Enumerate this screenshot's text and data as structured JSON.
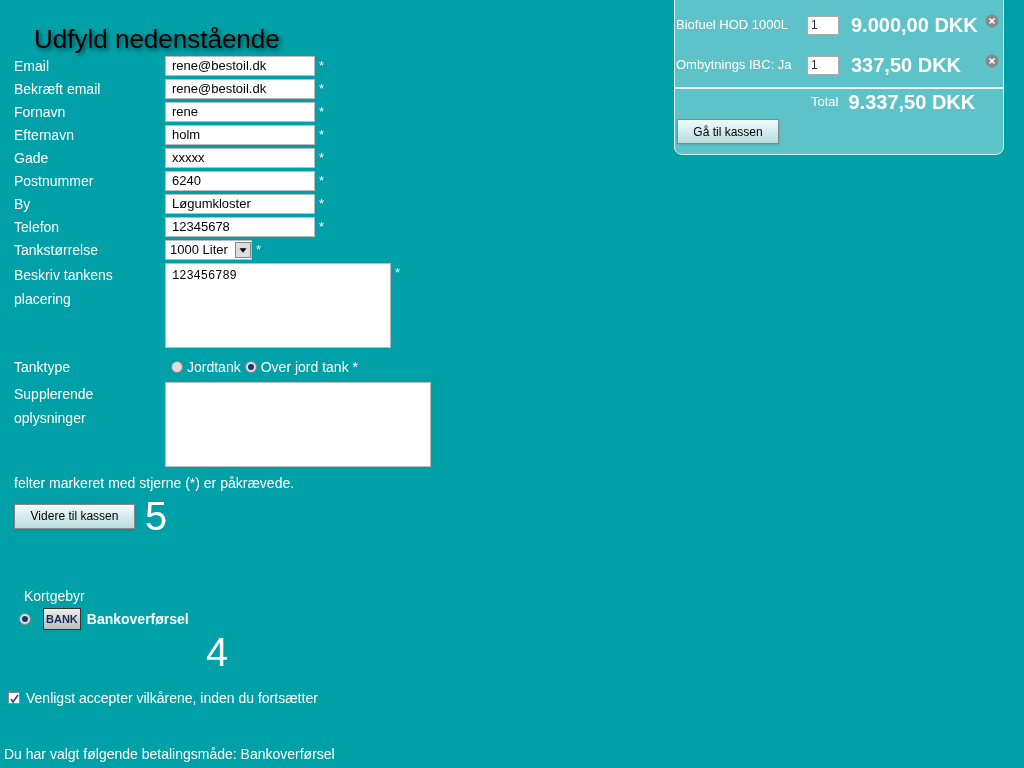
{
  "heading": "Udfyld nedenstående",
  "fields": [
    {
      "label": "Email",
      "value": "rene@bestoil.dk",
      "required": "*"
    },
    {
      "label": "Bekræft email",
      "value": "rene@bestoil.dk",
      "required": "*"
    },
    {
      "label": "Fornavn",
      "value": "rene",
      "required": "*"
    },
    {
      "label": "Efternavn",
      "value": "holm",
      "required": "*"
    },
    {
      "label": "Gade",
      "value": "xxxxx",
      "required": "*"
    },
    {
      "label": "Postnummer",
      "value": "6240",
      "required": "*"
    },
    {
      "label": "By",
      "value": "Løgumkloster",
      "required": "*"
    },
    {
      "label": "Telefon",
      "value": "12345678",
      "required": "*"
    }
  ],
  "tank_size": {
    "label": "Tankstørrelse",
    "value": "1000 Liter",
    "required": "*"
  },
  "placement": {
    "label": "Beskriv tankens placering",
    "value": "123456789",
    "required": "*"
  },
  "tank_type": {
    "label": "Tanktype",
    "options": [
      {
        "label": "Jordtank",
        "selected": false
      },
      {
        "label": "Over jord tank *",
        "selected": true
      }
    ]
  },
  "extra": {
    "label": "Supplerende oplysninger"
  },
  "note": "felter markeret med stjerne (*) er påkrævede.",
  "submit": "Videre til kassen",
  "step_a": "5",
  "fee_label": "Kortgebyr",
  "payment": {
    "logo_text": "BANK",
    "label": "Bankoverførsel",
    "selected": true
  },
  "step_b": "4",
  "terms": {
    "label": "Venligst accepter vilkårene, inden du fortsætter",
    "checked": true
  },
  "summary": "Du har valgt følgende betalingsmåde: Bankoverførsel",
  "cart": {
    "items": [
      {
        "name": "Biofuel HOD 1000L",
        "qty": "1",
        "price": "9.000,00 DKK"
      },
      {
        "name": "Ombytnings IBC: Ja",
        "qty": "1",
        "price": "337,50 DKK"
      }
    ],
    "total_label": "Total",
    "total": "9.337,50 DKK",
    "button": "Gå til kassen"
  }
}
